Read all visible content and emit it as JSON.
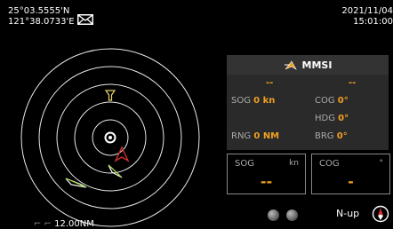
{
  "position": {
    "lat": "25°03.5555'N",
    "lon": "121°38.0733'E"
  },
  "datetime": {
    "date": "2021/11/04",
    "time": "15:01:00"
  },
  "radar": {
    "range_value": "12.00NM"
  },
  "mmsi_panel": {
    "title": "MMSI",
    "left_dash": "--",
    "right_dash": "--",
    "sog_label": "SOG",
    "sog_value": "0 kn",
    "cog_label": "COG",
    "cog_value": "0°",
    "hdg_label": "HDG",
    "hdg_value": "0°",
    "rng_label": "RNG",
    "rng_value": "0 NM",
    "brg_label": "BRG",
    "brg_value": "0°"
  },
  "sog_box": {
    "label": "SOG",
    "unit": "kn",
    "value": "--"
  },
  "cog_box": {
    "label": "COG",
    "unit": "°",
    "value": "-"
  },
  "orientation": {
    "label": "N-up"
  },
  "icons": [
    "mail-icon",
    "own-ship-icon",
    "ais-target-icon",
    "waypoint-icon",
    "compass-icon"
  ],
  "colors": {
    "accent": "#f0a020",
    "danger": "#d23030",
    "panel": "#2a2a2a"
  }
}
